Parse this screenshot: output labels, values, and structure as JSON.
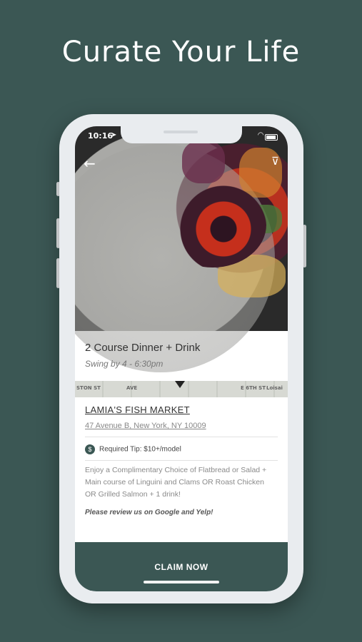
{
  "headline": "Curate Your Life",
  "status_bar": {
    "time": "10:16",
    "location_icon": "location-arrow-icon",
    "wifi_icon": "wifi-icon",
    "battery_icon": "battery-icon"
  },
  "hero": {
    "back_icon": "back-arrow-icon",
    "share_icon": "send-icon"
  },
  "offer": {
    "title": "2 Course Dinner + Drink",
    "subtitle": "Swing by 4 - 6:30pm"
  },
  "map": {
    "streets": [
      "STON ST",
      "AVE",
      "E 6TH ST",
      "Loisai"
    ]
  },
  "venue": {
    "name": "LAMIA'S FISH MARKET",
    "address": "47 Avenue B, New York, NY 10009"
  },
  "tip": {
    "icon": "dollar-icon",
    "label": "Required Tip: $10+/model"
  },
  "description": "Enjoy a Complimentary Choice of Flatbread or Salad + Main course of Linguini and Clams OR Roast Chicken OR Grilled Salmon + 1 drink!",
  "review_note": "Please review us on Google and Yelp!",
  "claim_button": "CLAIM NOW",
  "colors": {
    "background": "#3b5754",
    "accent": "#3b5754"
  }
}
